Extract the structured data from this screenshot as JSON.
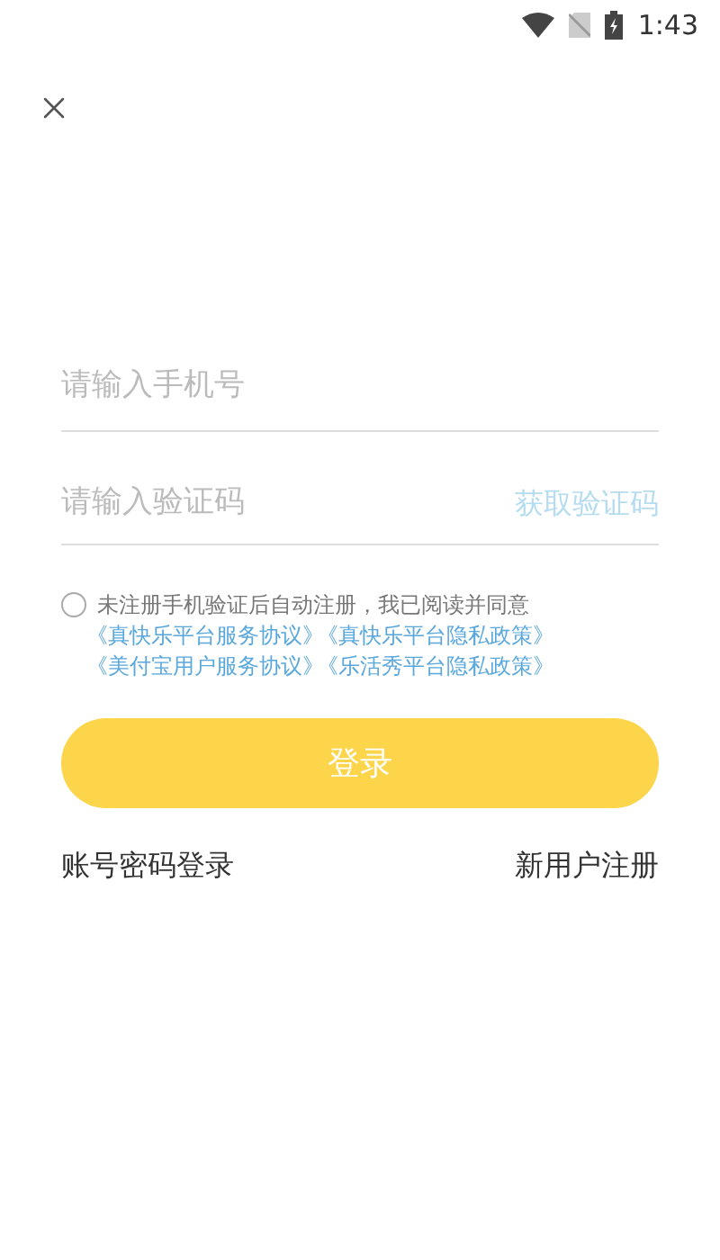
{
  "status_bar": {
    "time": "1:43"
  },
  "phone_field": {
    "placeholder": "请输入手机号"
  },
  "code_field": {
    "placeholder": "请输入验证码",
    "action": "获取验证码",
    "action_disabled": true
  },
  "agreement": {
    "checked": false,
    "text": "未注册手机验证后自动注册，我已阅读并同意",
    "links": [
      [
        "《真快乐平台服务协议》",
        "《真快乐平台隐私政策》"
      ],
      [
        "《美付宝用户服务协议》",
        "《乐活秀平台隐私政策》"
      ]
    ]
  },
  "login_button": {
    "label": "登录"
  },
  "footer_links": [
    "账号密码登录",
    "新用户注册"
  ]
}
